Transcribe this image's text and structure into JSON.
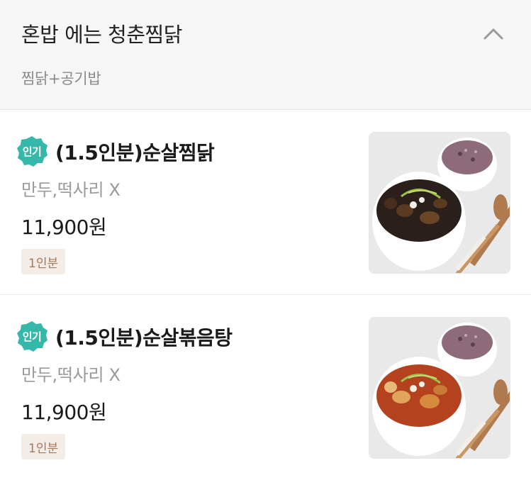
{
  "section": {
    "title": "혼밥 에는 청춘찜닭",
    "subtitle": "찜닭+공기밥",
    "toggle_icon": "chevron-up-icon"
  },
  "colors": {
    "badge": "#35b7a9",
    "tag_bg": "#f4ece6",
    "tag_text": "#a57a5c",
    "header_bg": "#f6f6f6"
  },
  "items": [
    {
      "badge": "인기",
      "name": "(1.5인분)순살찜닭",
      "description": "만두,떡사리 X",
      "price": "11,900원",
      "tag": "1인분",
      "image": "jjimdak-photo"
    },
    {
      "badge": "인기",
      "name": "(1.5인분)순살볶음탕",
      "description": "만두,떡사리 X",
      "price": "11,900원",
      "tag": "1인분",
      "image": "bokkeumtang-photo"
    }
  ]
}
